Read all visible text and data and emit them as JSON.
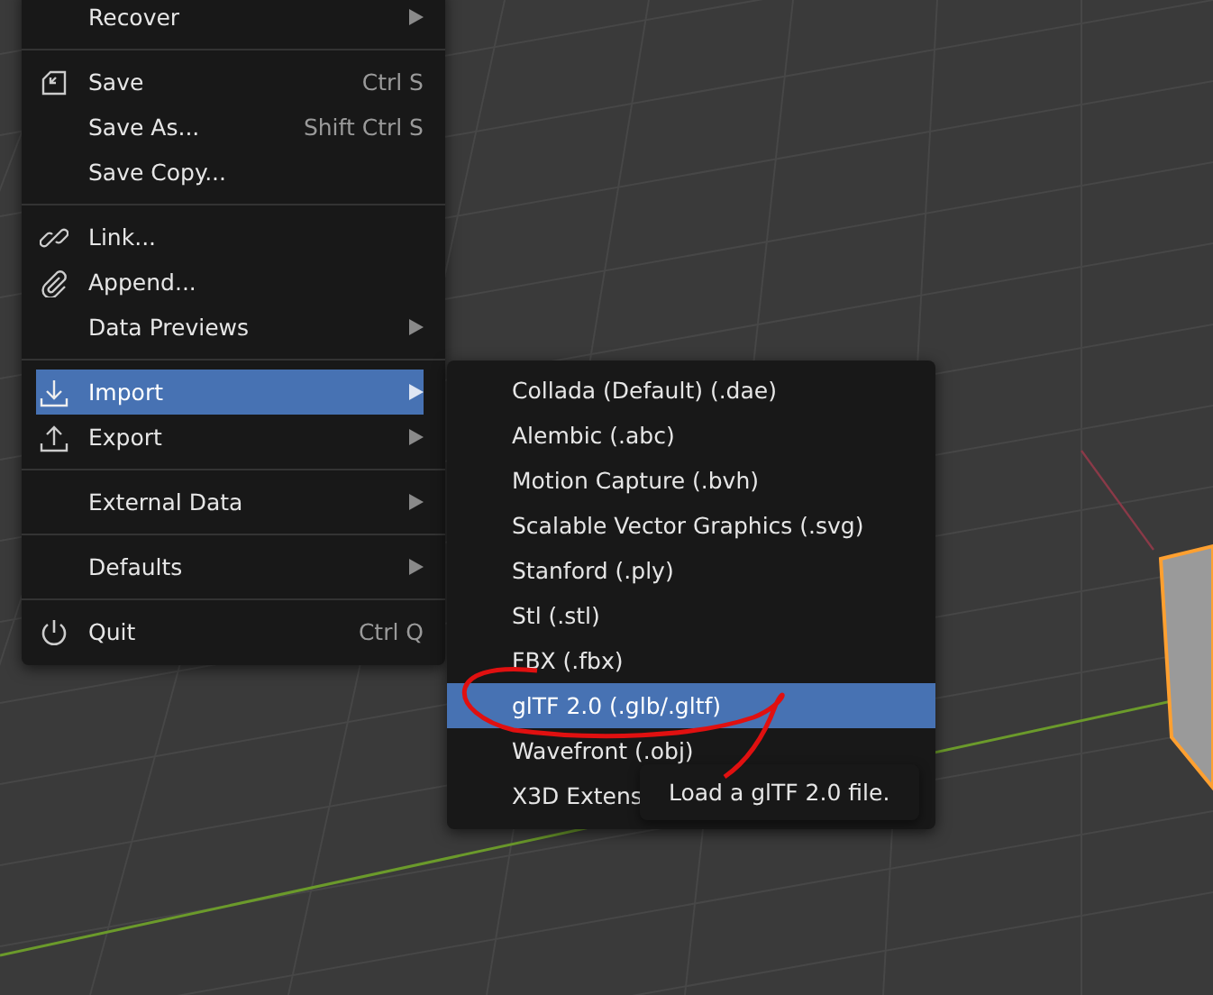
{
  "file_menu": {
    "items": [
      {
        "label": "Recover",
        "submenu": true,
        "separator_before": false,
        "selected": false
      },
      {
        "label": "Save",
        "shortcut": "Ctrl S",
        "submenu": false,
        "separator_before": true,
        "selected": false
      },
      {
        "label": "Save As...",
        "shortcut": "Shift Ctrl S",
        "submenu": false,
        "separator_before": false,
        "selected": false
      },
      {
        "label": "Save Copy...",
        "submenu": false,
        "separator_before": false,
        "selected": false
      },
      {
        "label": "Link...",
        "submenu": false,
        "separator_before": true,
        "selected": false
      },
      {
        "label": "Append...",
        "submenu": false,
        "separator_before": false,
        "selected": false
      },
      {
        "label": "Data Previews",
        "submenu": true,
        "separator_before": false,
        "selected": false
      },
      {
        "label": "Import",
        "submenu": true,
        "separator_before": true,
        "selected": true
      },
      {
        "label": "Export",
        "submenu": true,
        "separator_before": false,
        "selected": false
      },
      {
        "label": "External Data",
        "submenu": true,
        "separator_before": true,
        "selected": false
      },
      {
        "label": "Defaults",
        "submenu": true,
        "separator_before": true,
        "selected": false
      },
      {
        "label": "Quit",
        "shortcut": "Ctrl Q",
        "submenu": false,
        "separator_before": true,
        "selected": false
      }
    ]
  },
  "import_submenu": {
    "items": [
      {
        "label": "Collada (Default) (.dae)",
        "selected": false
      },
      {
        "label": "Alembic (.abc)",
        "selected": false
      },
      {
        "label": "Motion Capture (.bvh)",
        "selected": false
      },
      {
        "label": "Scalable Vector Graphics (.svg)",
        "selected": false
      },
      {
        "label": "Stanford (.ply)",
        "selected": false
      },
      {
        "label": "Stl (.stl)",
        "selected": false
      },
      {
        "label": "FBX (.fbx)",
        "selected": false
      },
      {
        "label": "glTF 2.0 (.glb/.gltf)",
        "selected": true
      },
      {
        "label": "Wavefront (.obj)",
        "selected": false
      },
      {
        "label": "X3D Extens",
        "selected": false
      }
    ]
  },
  "tooltip": {
    "text": "Load a glTF 2.0 file."
  }
}
